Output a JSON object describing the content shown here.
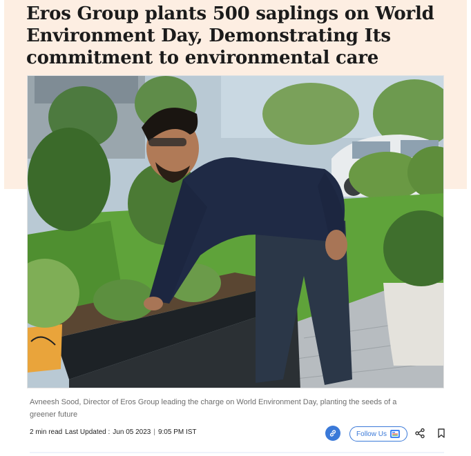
{
  "article": {
    "headline": "Eros Group plants 500 saplings on World Environment Day, Demonstrating Its commitment to environmental care",
    "caption": "Avneesh Sood, Director of Eros Group leading the charge on World Environment Day, planting the seeds of a greener future",
    "read_time": "2 min read",
    "last_updated_label": "Last Updated :",
    "date": "Jun 05 2023",
    "time": "9:05 PM IST",
    "separator": "|"
  },
  "actions": {
    "follow_label": "Follow Us"
  },
  "icons": {
    "link": "link-icon",
    "follow": "google-news-icon",
    "share": "share-icon",
    "bookmark": "bookmark-icon"
  },
  "colors": {
    "hero_band": "#fdeee2",
    "accent": "#3a79d8",
    "headline": "#1b1b1b",
    "caption": "#6c6c6c"
  }
}
